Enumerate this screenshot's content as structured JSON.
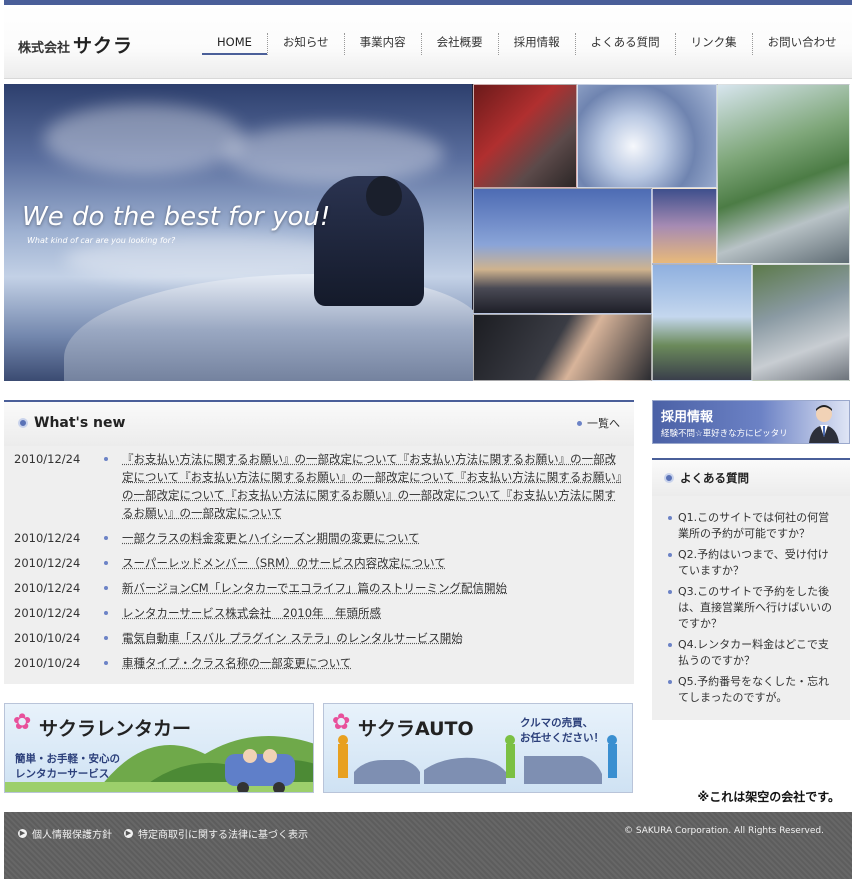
{
  "header": {
    "logo_prefix": "株式会社",
    "logo_name": "サクラ",
    "nav": [
      {
        "label": "HOME",
        "active": true
      },
      {
        "label": "お知らせ"
      },
      {
        "label": "事業内容"
      },
      {
        "label": "会社概要"
      },
      {
        "label": "採用情報"
      },
      {
        "label": "よくある質問"
      },
      {
        "label": "リンク集"
      },
      {
        "label": "お問い合わせ"
      }
    ]
  },
  "hero": {
    "title": "We do the best for you!",
    "subtitle": "What kind of car are you looking for?"
  },
  "whats_new": {
    "title": "What's new",
    "more_label": "一覧へ",
    "items": [
      {
        "date": "2010/12/24",
        "text": "『お支払い方法に関するお願い』の一部改定について『お支払い方法に関するお願い』の一部改定について『お支払い方法に関するお願い』の一部改定について『お支払い方法に関するお願い』の一部改定について『お支払い方法に関するお願い』の一部改定について『お支払い方法に関するお願い』の一部改定について"
      },
      {
        "date": "2010/12/24",
        "text": "一部クラスの料金変更とハイシーズン期間の変更について"
      },
      {
        "date": "2010/12/24",
        "text": "スーパーレッドメンバー（SRM）のサービス内容改定について"
      },
      {
        "date": "2010/12/24",
        "text": "新バージョンCM「レンタカーでエコライフ」篇のストリーミング配信開始"
      },
      {
        "date": "2010/12/24",
        "text": "レンタカーサービス株式会社　2010年　年頭所感"
      },
      {
        "date": "2010/10/24",
        "text": "電気自動車「スバル プラグイン ステラ」のレンタルサービス開始"
      },
      {
        "date": "2010/10/24",
        "text": "車種タイプ・クラス名称の一部変更について"
      }
    ]
  },
  "recruit_banner": {
    "title": "採用情報",
    "subtitle": "経験不問☆車好きな方にピッタリ"
  },
  "faq": {
    "title": "よくある質問",
    "items": [
      "Q1.このサイトでは何社の何営業所の予約が可能ですか？",
      "Q2.予約はいつまで、受け付けていますか？",
      "Q3.このサイトで予約をした後は、直接営業所へ行けばいいのですか？",
      "Q4.レンタカー料金はどこで支払うのですか？",
      "Q5.予約番号をなくした・忘れてしまったのですが。"
    ]
  },
  "banners": {
    "rental": {
      "title": "サクラレンタカー",
      "subtitle": "簡単・お手軽・安心の\nレンタカーサービス"
    },
    "auto": {
      "title": "サクラAUTO",
      "subtitle": "クルマの売買、\nお任せください！"
    }
  },
  "note": "※これは架空の会社です。",
  "footer": {
    "links": [
      "個人情報保護方針",
      "特定商取引に関する法律に基づく表示"
    ],
    "copyright": "© SAKURA Corporation. All Rights Reserved."
  },
  "colors": {
    "accent": "#4a5f99",
    "link_dot": "#6c83c6",
    "flower": "#e8509b"
  }
}
